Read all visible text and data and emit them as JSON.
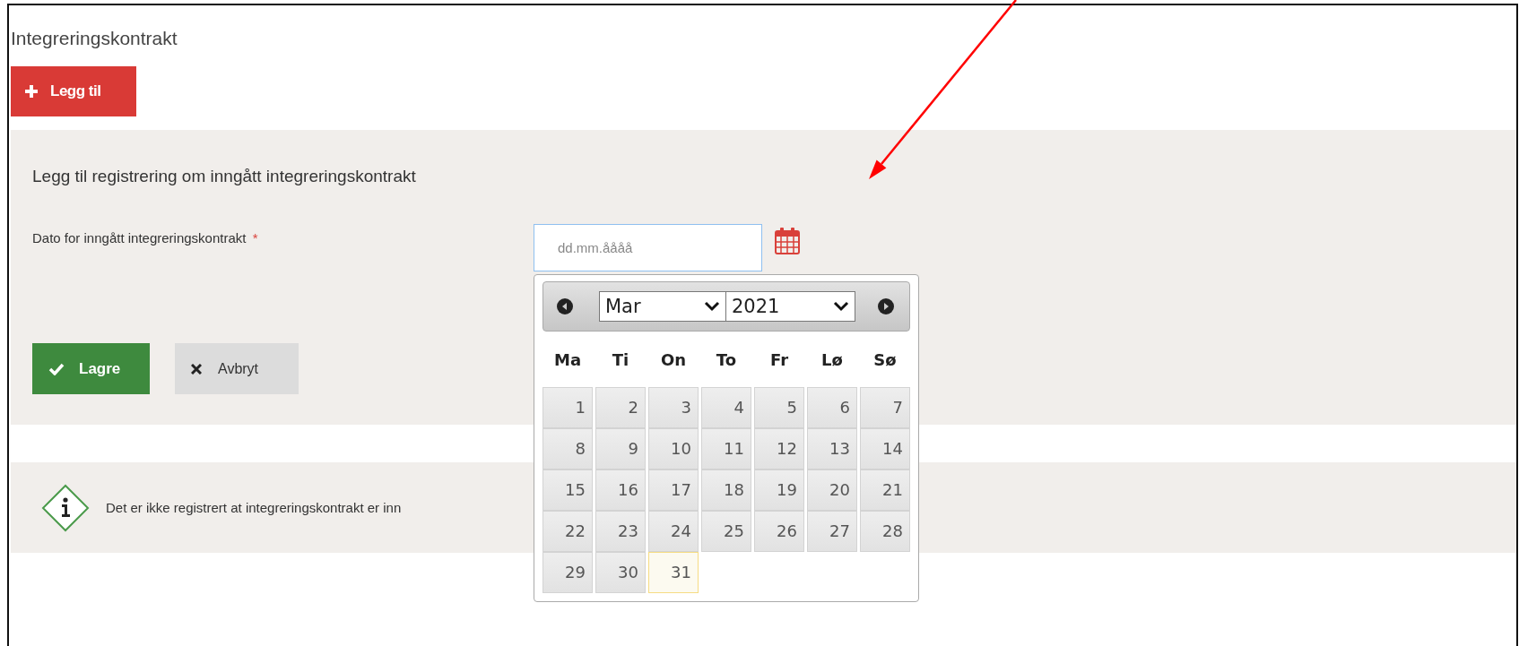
{
  "page": {
    "title": "Integreringskontrakt",
    "add_button": "Legg til"
  },
  "form": {
    "heading": "Legg til registrering om inngått integreringskontrakt",
    "date_label": "Dato for inngått integreringskontrakt",
    "required_mark": "*",
    "date_field": {
      "placeholder": "dd.mm.åååå"
    },
    "save_button": "Lagre",
    "cancel_button": "Avbryt"
  },
  "datepicker": {
    "month": "Mar",
    "year": "2021",
    "weekdays": [
      "Ma",
      "Ti",
      "On",
      "To",
      "Fr",
      "Lø",
      "Sø"
    ],
    "weeks": [
      [
        {
          "day": "1",
          "today": false
        },
        {
          "day": "2",
          "today": false
        },
        {
          "day": "3",
          "today": false
        },
        {
          "day": "4",
          "today": false
        },
        {
          "day": "5",
          "today": false
        },
        {
          "day": "6",
          "today": false
        },
        {
          "day": "7",
          "today": false
        }
      ],
      [
        {
          "day": "8",
          "today": false
        },
        {
          "day": "9",
          "today": false
        },
        {
          "day": "10",
          "today": false
        },
        {
          "day": "11",
          "today": false
        },
        {
          "day": "12",
          "today": false
        },
        {
          "day": "13",
          "today": false
        },
        {
          "day": "14",
          "today": false
        }
      ],
      [
        {
          "day": "15",
          "today": false
        },
        {
          "day": "16",
          "today": false
        },
        {
          "day": "17",
          "today": false
        },
        {
          "day": "18",
          "today": false
        },
        {
          "day": "19",
          "today": false
        },
        {
          "day": "20",
          "today": false
        },
        {
          "day": "21",
          "today": false
        }
      ],
      [
        {
          "day": "22",
          "today": false
        },
        {
          "day": "23",
          "today": false
        },
        {
          "day": "24",
          "today": false
        },
        {
          "day": "25",
          "today": false
        },
        {
          "day": "26",
          "today": false
        },
        {
          "day": "27",
          "today": false
        },
        {
          "day": "28",
          "today": false
        }
      ],
      [
        {
          "day": "29",
          "today": false
        },
        {
          "day": "30",
          "today": false
        },
        {
          "day": "31",
          "today": true
        }
      ]
    ]
  },
  "info": {
    "text": "Det er ikke registrert at integreringskontrakt er inn"
  }
}
